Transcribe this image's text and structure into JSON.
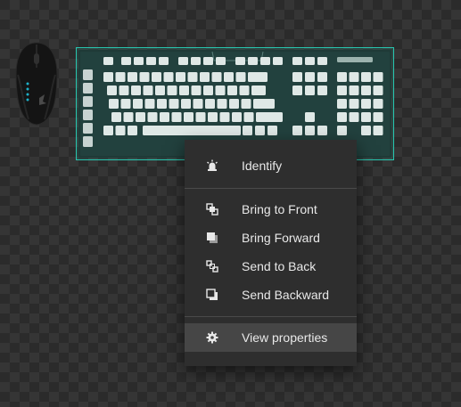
{
  "canvas": {
    "background": "#2b2b2b",
    "devices": [
      {
        "kind": "mouse",
        "icon": "gaming-mouse-image"
      },
      {
        "kind": "keyboard",
        "icon": "keyboard-image",
        "selected": true,
        "selection_color": "#27c7b0"
      }
    ]
  },
  "context_menu": {
    "groups": [
      [
        {
          "label": "Identify",
          "icon": "beacon-icon"
        }
      ],
      [
        {
          "label": "Bring to Front",
          "icon": "bring-to-front-icon"
        },
        {
          "label": "Bring Forward",
          "icon": "bring-forward-icon"
        },
        {
          "label": "Send to Back",
          "icon": "send-to-back-icon"
        },
        {
          "label": "Send Backward",
          "icon": "send-backward-icon"
        }
      ],
      [
        {
          "label": "View properties",
          "icon": "gear-icon",
          "highlighted": true
        }
      ]
    ],
    "highlight_color": "#464646"
  }
}
